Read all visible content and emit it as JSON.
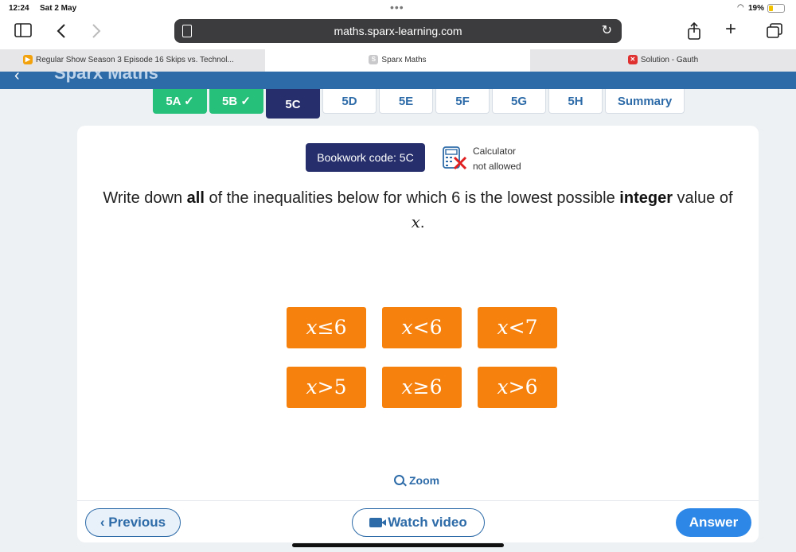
{
  "status_bar": {
    "time": "12:24",
    "date": "Sat 2 May",
    "battery": "19%"
  },
  "browser": {
    "url": "maths.sparx-learning.com",
    "tabs": [
      {
        "title": "Regular Show Season 3 Episode 16 Skips vs. Technol...",
        "active": false
      },
      {
        "title": "Sparx Maths",
        "active": true
      },
      {
        "title": "Solution - Gauth",
        "active": false
      }
    ]
  },
  "header": {
    "brand": "Sparx Maths"
  },
  "task_tabs": [
    {
      "label": "5A",
      "state": "done"
    },
    {
      "label": "5B",
      "state": "done"
    },
    {
      "label": "5C",
      "state": "current"
    },
    {
      "label": "5D",
      "state": "todo"
    },
    {
      "label": "5E",
      "state": "todo"
    },
    {
      "label": "5F",
      "state": "todo"
    },
    {
      "label": "5G",
      "state": "todo"
    },
    {
      "label": "5H",
      "state": "todo"
    },
    {
      "label": "Summary",
      "state": "todo"
    }
  ],
  "question": {
    "bookwork_code": "Bookwork code: 5C",
    "calculator_line1": "Calculator",
    "calculator_line2": "not allowed",
    "text_part1": "Write down ",
    "text_bold1": "all",
    "text_part2": " of the inequalities below for which 6 is the lowest possible ",
    "text_bold2": "integer",
    "text_part3": " value of ",
    "variable": "x",
    "text_part4": ".",
    "options": [
      {
        "var": "x",
        "op": "≤",
        "num": "6"
      },
      {
        "var": "x",
        "op": "<",
        "num": "6"
      },
      {
        "var": "x",
        "op": "<",
        "num": "7"
      },
      {
        "var": "x",
        "op": ">",
        "num": "5"
      },
      {
        "var": "x",
        "op": "≥",
        "num": "6"
      },
      {
        "var": "x",
        "op": ">",
        "num": "6"
      }
    ]
  },
  "footer": {
    "zoom_label": "Zoom",
    "previous_label": "Previous",
    "watch_label": "Watch video",
    "answer_label": "Answer"
  },
  "colors": {
    "brand_blue": "#2d6ba8",
    "done_green": "#27c07a",
    "navy": "#262f6b",
    "option_orange": "#f6820d",
    "answer_blue": "#2d87e6"
  }
}
